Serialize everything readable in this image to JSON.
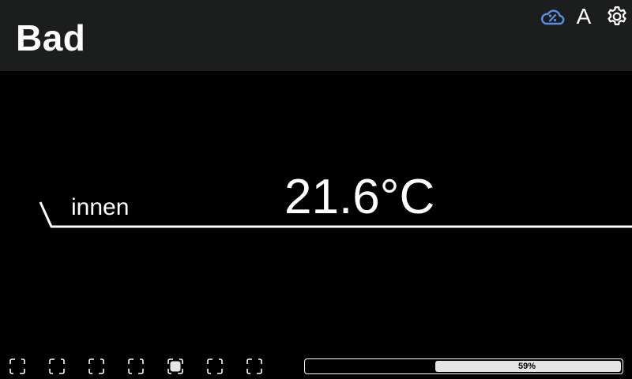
{
  "header": {
    "title": "Bad",
    "icons": {
      "cloud": "cloud-percent-icon",
      "font": "A",
      "settings": "gear-icon"
    }
  },
  "sensor": {
    "label": "innen",
    "value": "21.6°C"
  },
  "pager": {
    "count": 7,
    "active_index": 4
  },
  "progress": {
    "value": 0.59,
    "label": "59%"
  },
  "colors": {
    "background": "#000000",
    "header_background": "#1b1e1c",
    "cloud_icon": "#5b8ee3",
    "foreground": "#ffffff",
    "progress_fill": "#e4e4e4"
  }
}
